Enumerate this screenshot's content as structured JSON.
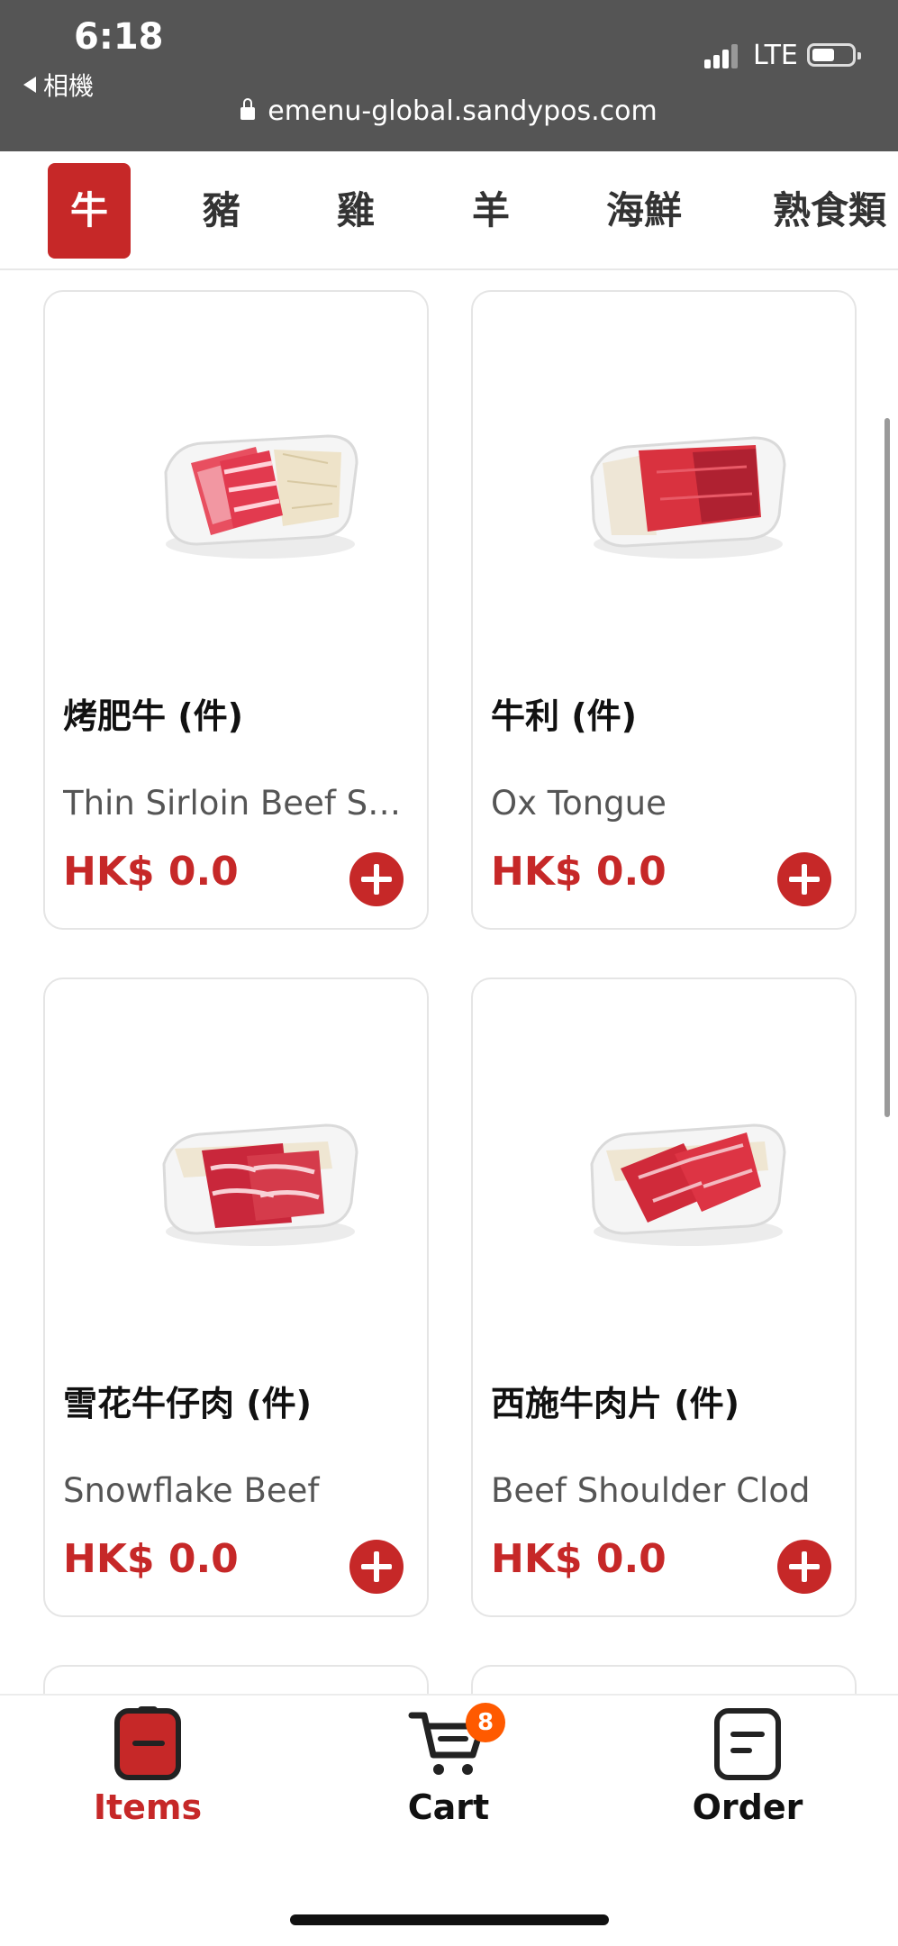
{
  "status_bar": {
    "time": "6:18",
    "back_app": "相機",
    "network": "LTE",
    "url": "emenu-global.sandypos.com"
  },
  "tabs": [
    {
      "label": "牛",
      "active": true
    },
    {
      "label": "豬",
      "active": false
    },
    {
      "label": "雞",
      "active": false
    },
    {
      "label": "羊",
      "active": false
    },
    {
      "label": "海鮮",
      "active": false
    },
    {
      "label": "熟食類",
      "active": false
    }
  ],
  "products": [
    {
      "name": "烤肥牛 (件)",
      "desc": "Thin Sirloin Beef Slices",
      "price": "HK$ 0.0",
      "image": "fatty-beef-slices-image"
    },
    {
      "name": "牛利 (件)",
      "desc": "Ox Tongue",
      "price": "HK$ 0.0",
      "image": "ox-tongue-image"
    },
    {
      "name": "雪花牛仔肉 (件)",
      "desc": "Snowflake Beef",
      "price": "HK$ 0.0",
      "image": "snowflake-beef-image"
    },
    {
      "name": "西施牛肉片 (件)",
      "desc": "Beef Shoulder Clod",
      "price": "HK$ 0.0",
      "image": "beef-shoulder-clod-image"
    }
  ],
  "nav": {
    "items_label": "Items",
    "cart_label": "Cart",
    "cart_badge": "8",
    "order_label": "Order"
  },
  "colors": {
    "accent": "#c62828",
    "badge": "#ff5a00",
    "status_bar": "#555555"
  }
}
